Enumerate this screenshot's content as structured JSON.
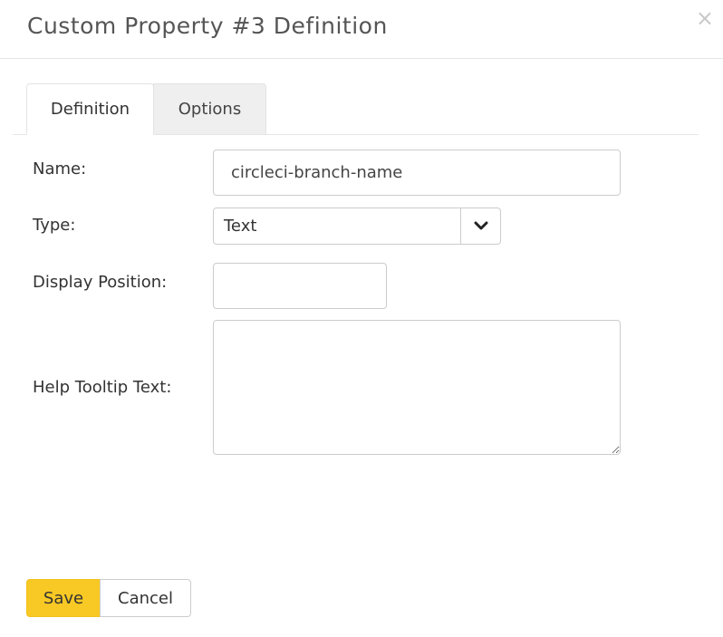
{
  "dialog": {
    "title": "Custom Property #3 Definition",
    "close_symbol": "×"
  },
  "tabs": [
    {
      "label": "Definition",
      "active": true
    },
    {
      "label": "Options",
      "active": false
    }
  ],
  "form": {
    "name": {
      "label": "Name:",
      "value": "circleci-branch-name"
    },
    "type": {
      "label": "Type:",
      "value": "Text",
      "icon": "chevron-down-icon"
    },
    "display_position": {
      "label": "Display Position:",
      "value": ""
    },
    "help_tooltip": {
      "label": "Help Tooltip Text:",
      "value": ""
    }
  },
  "buttons": {
    "save_label": "Save",
    "cancel_label": "Cancel"
  },
  "colors": {
    "save_button": "#f8c924",
    "inactive_tab": "#efefef"
  }
}
